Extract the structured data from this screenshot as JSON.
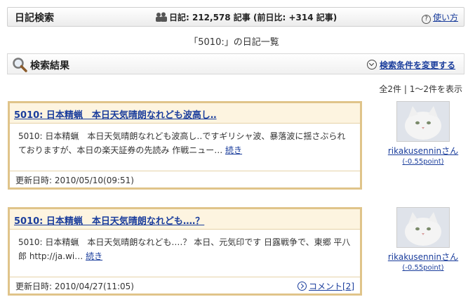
{
  "header": {
    "title": "日記検索",
    "stats": "日記: 212,578 記事 (前日比: +314 記事)",
    "help_label": "使い方"
  },
  "page_heading": "「5010:」の日記一覧",
  "results_bar": {
    "title": "検索結果",
    "change_label": "検索条件を変更する"
  },
  "result_count": "全2件 | 1〜2件を表示",
  "entries": [
    {
      "title": "5010: 日本精蝋　本日天気晴朗なれども波高し‥",
      "excerpt": "5010: 日本精蝋　本日天気晴朗なれども波高し‥ですギリシャ波、暴落波に揺さぶられておりますが、本日の楽天証券の先読み 作戦ニュー…",
      "more_label": "続き",
      "updated": "更新日時: 2010/05/10(09:51)",
      "comment_label": "",
      "user": {
        "name": "rikakusenninさん",
        "point": "(-0.55point)"
      }
    },
    {
      "title": "5010: 日本精蝋　本日天気晴朗なれども‥‥？",
      "excerpt": "5010: 日本精蝋　本日天気晴朗なれども‥‥？ 本日、元気印です 日露戦争で、東郷 平八郎 http://ja.wi…",
      "more_label": "続き",
      "updated": "更新日時: 2010/04/27(11:05)",
      "comment_label": "コメント[2]",
      "user": {
        "name": "rikakusenninさん",
        "point": "(-0.55point)"
      }
    }
  ]
}
